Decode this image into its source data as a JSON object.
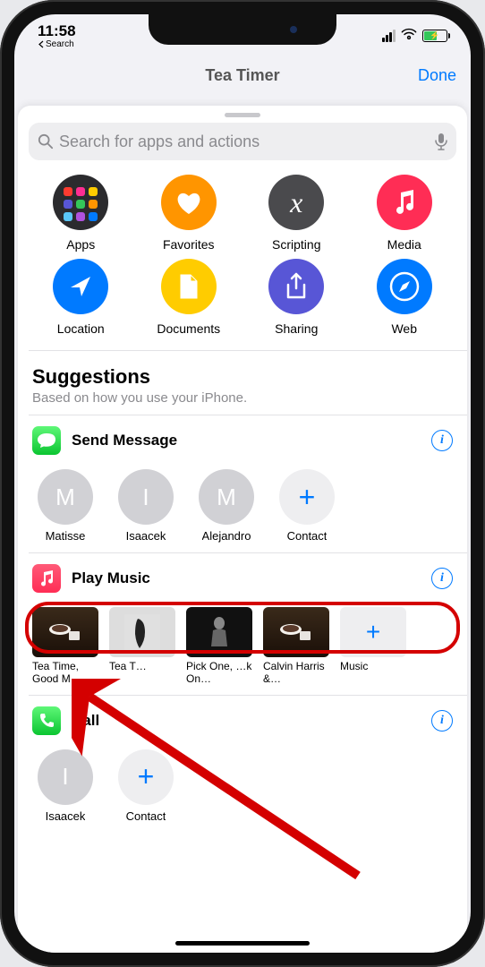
{
  "status": {
    "time": "11:58",
    "back_label": "Search"
  },
  "nav": {
    "title": "Tea Timer",
    "done": "Done"
  },
  "search": {
    "placeholder": "Search for apps and actions"
  },
  "categories": [
    {
      "label": "Apps"
    },
    {
      "label": "Favorites"
    },
    {
      "label": "Scripting"
    },
    {
      "label": "Media"
    },
    {
      "label": "Location"
    },
    {
      "label": "Documents"
    },
    {
      "label": "Sharing"
    },
    {
      "label": "Web"
    }
  ],
  "suggestions": {
    "title": "Suggestions",
    "subtitle": "Based on how you use your iPhone."
  },
  "send_message": {
    "title": "Send Message",
    "contacts": [
      {
        "initial": "M",
        "name": "Matisse"
      },
      {
        "initial": "I",
        "name": "Isaacek"
      },
      {
        "initial": "M",
        "name": "Alejandro"
      }
    ],
    "add_label": "Contact"
  },
  "play_music": {
    "title": "Play Music",
    "items": [
      {
        "label": "Tea Time, Good M…"
      },
      {
        "label": "Tea T…"
      },
      {
        "label": "Pick One, …k On…"
      },
      {
        "label": "Calvin Harris &…"
      }
    ],
    "add_label": "Music"
  },
  "call": {
    "title": "Call",
    "contacts": [
      {
        "initial": "I",
        "name": "Isaacek"
      }
    ],
    "add_label": "Contact"
  }
}
